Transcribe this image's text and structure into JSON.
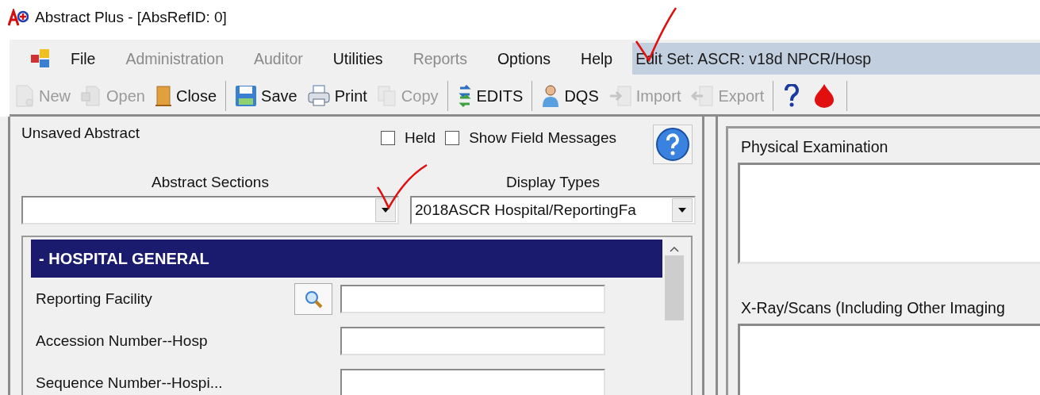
{
  "window": {
    "title": "Abstract Plus - [AbsRefID: 0]"
  },
  "menu": [
    {
      "label": "File",
      "disabled": false
    },
    {
      "label": "Administration",
      "disabled": true
    },
    {
      "label": "Auditor",
      "disabled": true
    },
    {
      "label": "Utilities",
      "disabled": false
    },
    {
      "label": "Reports",
      "disabled": true
    },
    {
      "label": "Options",
      "disabled": false
    },
    {
      "label": "Help",
      "disabled": false
    }
  ],
  "edit_set": "Edit Set: ASCR: v18d NPCR/Hosp",
  "toolbar": [
    {
      "kind": "button",
      "label": "New",
      "disabled": true
    },
    {
      "kind": "button",
      "label": "Open",
      "disabled": true
    },
    {
      "kind": "button",
      "label": "Close",
      "disabled": false
    },
    {
      "kind": "separator"
    },
    {
      "kind": "button",
      "label": "Save",
      "disabled": false
    },
    {
      "kind": "button",
      "label": "Print",
      "disabled": false
    },
    {
      "kind": "button",
      "label": "Copy",
      "disabled": true
    },
    {
      "kind": "separator"
    },
    {
      "kind": "button",
      "label": "EDITS",
      "disabled": false
    },
    {
      "kind": "separator"
    },
    {
      "kind": "button",
      "label": "DQS",
      "disabled": false
    },
    {
      "kind": "button",
      "label": "Import",
      "disabled": true
    },
    {
      "kind": "button",
      "label": "Export",
      "disabled": true
    },
    {
      "kind": "separator"
    },
    {
      "kind": "icon"
    },
    {
      "kind": "icon"
    },
    {
      "kind": "separator"
    }
  ],
  "abstract": {
    "status": "Unsaved Abstract",
    "checkboxes": [
      {
        "label": "Held",
        "checked": false
      },
      {
        "label": "Show Field Messages",
        "checked": false
      }
    ],
    "sections_label": "Abstract Sections",
    "display_types_label": "Display Types",
    "display_type": "2018ASCR Hospital/ReportingFa",
    "section_header": "- HOSPITAL GENERAL",
    "fields": [
      {
        "label": "Reporting Facility",
        "lookup": true
      },
      {
        "label": "Accession Number--Hosp",
        "lookup": false
      },
      {
        "label": "Sequence Number--Hospi...",
        "lookup": false
      }
    ]
  },
  "notes": [
    {
      "label": "Physical Examination"
    },
    {
      "label": "X-Ray/Scans (Including Other Imaging"
    }
  ]
}
